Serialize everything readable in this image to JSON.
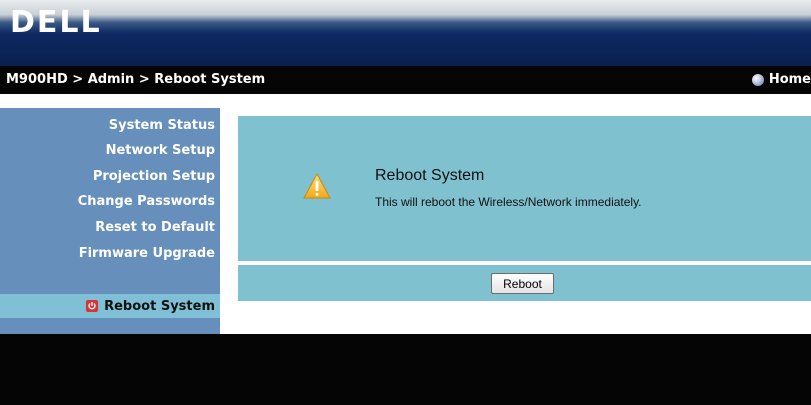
{
  "header": {
    "logo_text": "DELL"
  },
  "breadcrumb": {
    "text": "M900HD > Admin > Reboot System"
  },
  "home_link": {
    "label": "Home",
    "icon": "home-dot-icon"
  },
  "sidebar": {
    "items": [
      {
        "label": "System Status"
      },
      {
        "label": "Network Setup"
      },
      {
        "label": "Projection Setup"
      },
      {
        "label": "Change Passwords"
      },
      {
        "label": "Reset to Default"
      },
      {
        "label": "Firmware Upgrade"
      }
    ],
    "active_item": {
      "label": "Reboot System",
      "icon": "power-icon"
    }
  },
  "main": {
    "title": "Reboot System",
    "message": "This will reboot the Wireless/Network immediately.",
    "warning_icon": "warning-triangle-icon",
    "button_label": "Reboot"
  },
  "colors": {
    "sidebar_bg": "#6690bb",
    "active_bg": "#7fc0d6",
    "panel_bg": "#80c1d0",
    "header_bg": "#0e2a63",
    "bar_bg": "#050505"
  }
}
